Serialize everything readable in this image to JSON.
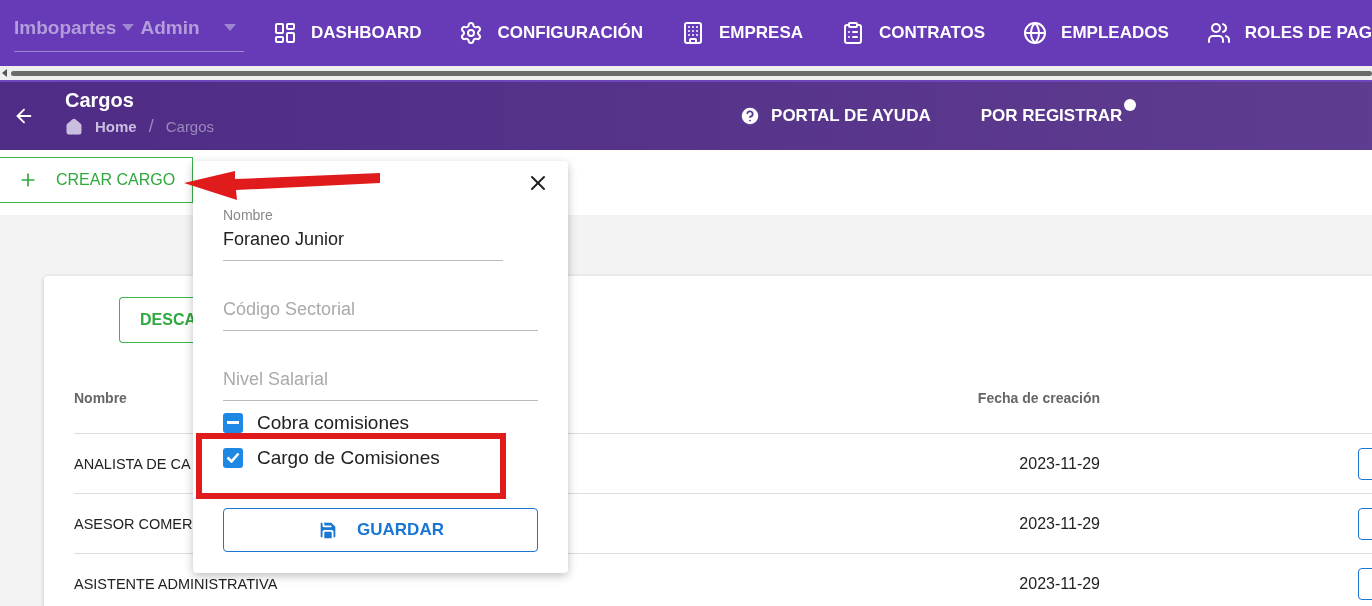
{
  "top_bar": {
    "company": "Imbopartes",
    "role": "Admin",
    "nav": [
      "DASHBOARD",
      "CONFIGURACIÓN",
      "EMPRESA",
      "CONTRATOS",
      "EMPLEADOS",
      "ROLES DE PAG"
    ]
  },
  "header": {
    "title": "Cargos",
    "breadcrumb": [
      "Home",
      "/",
      "Cargos"
    ],
    "help": "PORTAL DE AYUDA",
    "register": "POR REGISTRAR"
  },
  "create_button": "CREAR CARGO",
  "download_button": "DESCA",
  "table": {
    "columns": [
      "Nombre",
      "Fecha de creación"
    ],
    "rows": [
      {
        "name": "ANALISTA DE CA",
        "date": "2023-11-29"
      },
      {
        "name": "ASESOR COMER",
        "date": "2023-11-29"
      },
      {
        "name": "ASISTENTE ADMINISTRATIVA",
        "date": "2023-11-29"
      }
    ]
  },
  "dialog": {
    "fields": [
      {
        "label": "Nombre",
        "value": "Foraneo Junior"
      },
      {
        "placeholder": "Código Sectorial"
      },
      {
        "placeholder": "Nivel Salarial"
      }
    ],
    "checkboxes": [
      {
        "label": "Cobra comisiones",
        "checked": true,
        "indeterminate": true
      },
      {
        "label": "Cargo de Comisiones",
        "checked": true,
        "indeterminate": false
      }
    ],
    "save": "GUARDAR"
  }
}
